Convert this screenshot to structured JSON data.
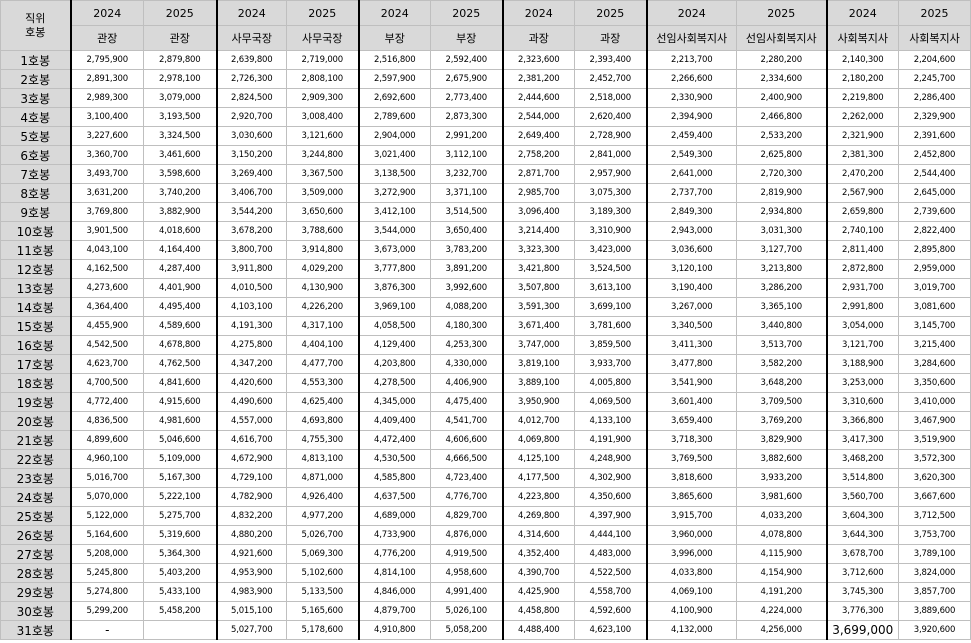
{
  "header": {
    "corner_line1": "직위",
    "corner_line2": "호봉",
    "groups": [
      {
        "years": [
          "2024",
          "2025"
        ],
        "titles": [
          "관장",
          "관장"
        ]
      },
      {
        "years": [
          "2024",
          "2025"
        ],
        "titles": [
          "사무국장",
          "사무국장"
        ]
      },
      {
        "years": [
          "2024",
          "2025"
        ],
        "titles": [
          "부장",
          "부장"
        ]
      },
      {
        "years": [
          "2024",
          "2025"
        ],
        "titles": [
          "과장",
          "과장"
        ]
      },
      {
        "years": [
          "2024",
          "2025"
        ],
        "titles": [
          "선임사회복지사",
          "선임사회복지사"
        ]
      },
      {
        "years": [
          "2024",
          "2025"
        ],
        "titles": [
          "사회복지사",
          "사회복지사"
        ]
      }
    ]
  },
  "rows": [
    {
      "grade": "1호봉",
      "values": [
        "2,795,900",
        "2,879,800",
        "2,639,800",
        "2,719,000",
        "2,516,800",
        "2,592,400",
        "2,323,600",
        "2,393,400",
        "2,213,700",
        "2,280,200",
        "2,140,300",
        "2,204,600"
      ]
    },
    {
      "grade": "2호봉",
      "values": [
        "2,891,300",
        "2,978,100",
        "2,726,300",
        "2,808,100",
        "2,597,900",
        "2,675,900",
        "2,381,200",
        "2,452,700",
        "2,266,600",
        "2,334,600",
        "2,180,200",
        "2,245,700"
      ]
    },
    {
      "grade": "3호봉",
      "values": [
        "2,989,300",
        "3,079,000",
        "2,824,500",
        "2,909,300",
        "2,692,600",
        "2,773,400",
        "2,444,600",
        "2,518,000",
        "2,330,900",
        "2,400,900",
        "2,219,800",
        "2,286,400"
      ]
    },
    {
      "grade": "4호봉",
      "values": [
        "3,100,400",
        "3,193,500",
        "2,920,700",
        "3,008,400",
        "2,789,600",
        "2,873,300",
        "2,544,000",
        "2,620,400",
        "2,394,900",
        "2,466,800",
        "2,262,000",
        "2,329,900"
      ]
    },
    {
      "grade": "5호봉",
      "values": [
        "3,227,600",
        "3,324,500",
        "3,030,600",
        "3,121,600",
        "2,904,000",
        "2,991,200",
        "2,649,400",
        "2,728,900",
        "2,459,400",
        "2,533,200",
        "2,321,900",
        "2,391,600"
      ]
    },
    {
      "grade": "6호봉",
      "values": [
        "3,360,700",
        "3,461,600",
        "3,150,200",
        "3,244,800",
        "3,021,400",
        "3,112,100",
        "2,758,200",
        "2,841,000",
        "2,549,300",
        "2,625,800",
        "2,381,300",
        "2,452,800"
      ]
    },
    {
      "grade": "7호봉",
      "values": [
        "3,493,700",
        "3,598,600",
        "3,269,400",
        "3,367,500",
        "3,138,500",
        "3,232,700",
        "2,871,700",
        "2,957,900",
        "2,641,000",
        "2,720,300",
        "2,470,200",
        "2,544,400"
      ]
    },
    {
      "grade": "8호봉",
      "values": [
        "3,631,200",
        "3,740,200",
        "3,406,700",
        "3,509,000",
        "3,272,900",
        "3,371,100",
        "2,985,700",
        "3,075,300",
        "2,737,700",
        "2,819,900",
        "2,567,900",
        "2,645,000"
      ]
    },
    {
      "grade": "9호봉",
      "values": [
        "3,769,800",
        "3,882,900",
        "3,544,200",
        "3,650,600",
        "3,412,100",
        "3,514,500",
        "3,096,400",
        "3,189,300",
        "2,849,300",
        "2,934,800",
        "2,659,800",
        "2,739,600"
      ]
    },
    {
      "grade": "10호봉",
      "values": [
        "3,901,500",
        "4,018,600",
        "3,678,200",
        "3,788,600",
        "3,544,000",
        "3,650,400",
        "3,214,400",
        "3,310,900",
        "2,943,000",
        "3,031,300",
        "2,740,100",
        "2,822,400"
      ]
    },
    {
      "grade": "11호봉",
      "values": [
        "4,043,100",
        "4,164,400",
        "3,800,700",
        "3,914,800",
        "3,673,000",
        "3,783,200",
        "3,323,300",
        "3,423,000",
        "3,036,600",
        "3,127,700",
        "2,811,400",
        "2,895,800"
      ]
    },
    {
      "grade": "12호봉",
      "values": [
        "4,162,500",
        "4,287,400",
        "3,911,800",
        "4,029,200",
        "3,777,800",
        "3,891,200",
        "3,421,800",
        "3,524,500",
        "3,120,100",
        "3,213,800",
        "2,872,800",
        "2,959,000"
      ]
    },
    {
      "grade": "13호봉",
      "values": [
        "4,273,600",
        "4,401,900",
        "4,010,500",
        "4,130,900",
        "3,876,300",
        "3,992,600",
        "3,507,800",
        "3,613,100",
        "3,190,400",
        "3,286,200",
        "2,931,700",
        "3,019,700"
      ]
    },
    {
      "grade": "14호봉",
      "values": [
        "4,364,400",
        "4,495,400",
        "4,103,100",
        "4,226,200",
        "3,969,100",
        "4,088,200",
        "3,591,300",
        "3,699,100",
        "3,267,000",
        "3,365,100",
        "2,991,800",
        "3,081,600"
      ]
    },
    {
      "grade": "15호봉",
      "values": [
        "4,455,900",
        "4,589,600",
        "4,191,300",
        "4,317,100",
        "4,058,500",
        "4,180,300",
        "3,671,400",
        "3,781,600",
        "3,340,500",
        "3,440,800",
        "3,054,000",
        "3,145,700"
      ]
    },
    {
      "grade": "16호봉",
      "values": [
        "4,542,500",
        "4,678,800",
        "4,275,800",
        "4,404,100",
        "4,129,400",
        "4,253,300",
        "3,747,000",
        "3,859,500",
        "3,411,300",
        "3,513,700",
        "3,121,700",
        "3,215,400"
      ]
    },
    {
      "grade": "17호봉",
      "values": [
        "4,623,700",
        "4,762,500",
        "4,347,200",
        "4,477,700",
        "4,203,800",
        "4,330,000",
        "3,819,100",
        "3,933,700",
        "3,477,800",
        "3,582,200",
        "3,188,900",
        "3,284,600"
      ]
    },
    {
      "grade": "18호봉",
      "values": [
        "4,700,500",
        "4,841,600",
        "4,420,600",
        "4,553,300",
        "4,278,500",
        "4,406,900",
        "3,889,100",
        "4,005,800",
        "3,541,900",
        "3,648,200",
        "3,253,000",
        "3,350,600"
      ]
    },
    {
      "grade": "19호봉",
      "values": [
        "4,772,400",
        "4,915,600",
        "4,490,600",
        "4,625,400",
        "4,345,000",
        "4,475,400",
        "3,950,900",
        "4,069,500",
        "3,601,400",
        "3,709,500",
        "3,310,600",
        "3,410,000"
      ]
    },
    {
      "grade": "20호봉",
      "values": [
        "4,836,500",
        "4,981,600",
        "4,557,000",
        "4,693,800",
        "4,409,400",
        "4,541,700",
        "4,012,700",
        "4,133,100",
        "3,659,400",
        "3,769,200",
        "3,366,800",
        "3,467,900"
      ]
    },
    {
      "grade": "21호봉",
      "values": [
        "4,899,600",
        "5,046,600",
        "4,616,700",
        "4,755,300",
        "4,472,400",
        "4,606,600",
        "4,069,800",
        "4,191,900",
        "3,718,300",
        "3,829,900",
        "3,417,300",
        "3,519,900"
      ]
    },
    {
      "grade": "22호봉",
      "values": [
        "4,960,100",
        "5,109,000",
        "4,672,900",
        "4,813,100",
        "4,530,500",
        "4,666,500",
        "4,125,100",
        "4,248,900",
        "3,769,500",
        "3,882,600",
        "3,468,200",
        "3,572,300"
      ]
    },
    {
      "grade": "23호봉",
      "values": [
        "5,016,700",
        "5,167,300",
        "4,729,100",
        "4,871,000",
        "4,585,800",
        "4,723,400",
        "4,177,500",
        "4,302,900",
        "3,818,600",
        "3,933,200",
        "3,514,800",
        "3,620,300"
      ]
    },
    {
      "grade": "24호봉",
      "values": [
        "5,070,000",
        "5,222,100",
        "4,782,900",
        "4,926,400",
        "4,637,500",
        "4,776,700",
        "4,223,800",
        "4,350,600",
        "3,865,600",
        "3,981,600",
        "3,560,700",
        "3,667,600"
      ]
    },
    {
      "grade": "25호봉",
      "values": [
        "5,122,000",
        "5,275,700",
        "4,832,200",
        "4,977,200",
        "4,689,000",
        "4,829,700",
        "4,269,800",
        "4,397,900",
        "3,915,700",
        "4,033,200",
        "3,604,300",
        "3,712,500"
      ]
    },
    {
      "grade": "26호봉",
      "values": [
        "5,164,600",
        "5,319,600",
        "4,880,200",
        "5,026,700",
        "4,733,900",
        "4,876,000",
        "4,314,600",
        "4,444,100",
        "3,960,000",
        "4,078,800",
        "3,644,300",
        "3,753,700"
      ]
    },
    {
      "grade": "27호봉",
      "values": [
        "5,208,000",
        "5,364,300",
        "4,921,600",
        "5,069,300",
        "4,776,200",
        "4,919,500",
        "4,352,400",
        "4,483,000",
        "3,996,000",
        "4,115,900",
        "3,678,700",
        "3,789,100"
      ]
    },
    {
      "grade": "28호봉",
      "values": [
        "5,245,800",
        "5,403,200",
        "4,953,900",
        "5,102,600",
        "4,814,100",
        "4,958,600",
        "4,390,700",
        "4,522,500",
        "4,033,800",
        "4,154,900",
        "3,712,600",
        "3,824,000"
      ]
    },
    {
      "grade": "29호봉",
      "values": [
        "5,274,800",
        "5,433,100",
        "4,983,900",
        "5,133,500",
        "4,846,000",
        "4,991,400",
        "4,425,900",
        "4,558,700",
        "4,069,100",
        "4,191,200",
        "3,745,300",
        "3,857,700"
      ]
    },
    {
      "grade": "30호봉",
      "values": [
        "5,299,200",
        "5,458,200",
        "5,015,100",
        "5,165,600",
        "4,879,700",
        "5,026,100",
        "4,458,800",
        "4,592,600",
        "4,100,900",
        "4,224,000",
        "3,776,300",
        "3,889,600"
      ]
    },
    {
      "grade": "31호봉",
      "values": [
        "-",
        "",
        "5,027,700",
        "5,178,600",
        "4,910,800",
        "5,058,200",
        "4,488,400",
        "4,623,100",
        "4,132,000",
        "4,256,000",
        "3,699,000",
        "3,920,600"
      ]
    }
  ]
}
